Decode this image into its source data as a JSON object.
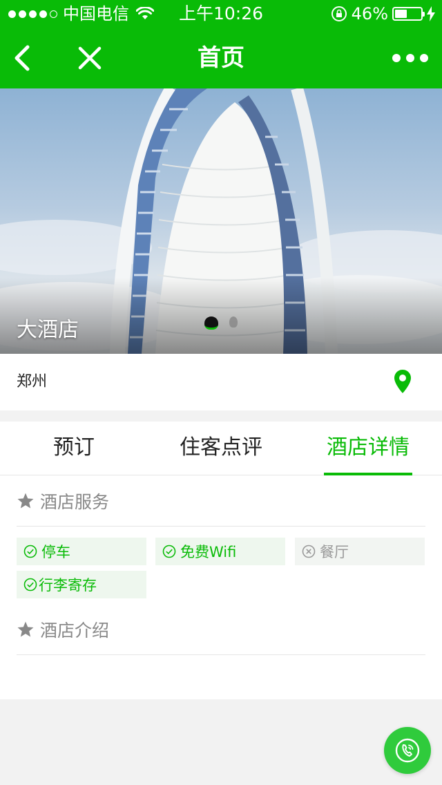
{
  "status_bar": {
    "carrier": "中国电信",
    "time": "上午10:26",
    "battery_percent": "46%",
    "battery_level": 0.46,
    "signal_bars": 4,
    "signal_max": 5
  },
  "navbar": {
    "title": "首页",
    "back_icon": "chevron-left-icon",
    "close_icon": "close-icon",
    "more_icon": "more-dots-icon"
  },
  "banner": {
    "hotel_name": "大酒店",
    "slide_count": 2,
    "active_slide": 1
  },
  "location": {
    "city": "郑州",
    "icon": "location-pin-icon"
  },
  "tabs": [
    {
      "label": "预订",
      "active": false
    },
    {
      "label": "住客点评",
      "active": false
    },
    {
      "label": "酒店详情",
      "active": true
    }
  ],
  "sections": {
    "services_title": "酒店服务",
    "intro_title": "酒店介绍"
  },
  "services": [
    {
      "label": "停车",
      "available": true
    },
    {
      "label": "免费Wifi",
      "available": true
    },
    {
      "label": "餐厅",
      "available": false
    },
    {
      "label": "行李寄存",
      "available": true
    }
  ],
  "colors": {
    "brand_green": "#09bb07",
    "fab_green": "#2fcb3c",
    "muted_gray": "#888888"
  },
  "fab": {
    "icon": "phone-icon"
  }
}
